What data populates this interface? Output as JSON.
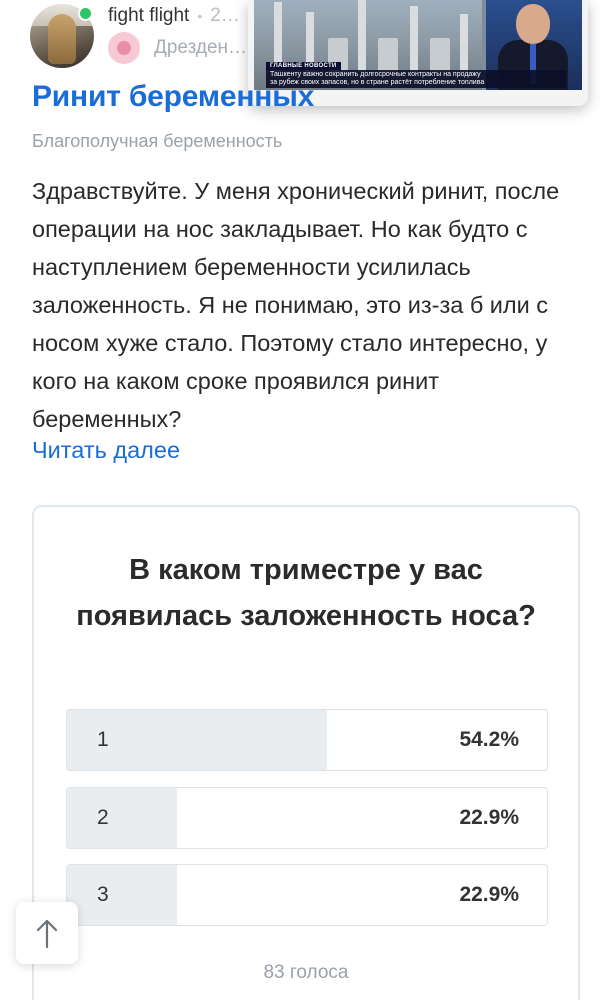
{
  "post": {
    "author": "fight flight",
    "date": "2…",
    "community": "Дрезден…",
    "title": "Ринит беременных",
    "tag": "Благополучная беременность",
    "body": "Здравствуйте. У меня хронический ринит, после операции на нос закладывает. Но как будто с наступлением беременности усилилась заложенность. Я не понимаю, это из-за б или с носом хуже стало. Поэтому стало интересно, у кого на каком сроке проявился ринит беременных?",
    "read_more": "Читать далее"
  },
  "pip_video": {
    "badge": "ГЛАВНЫЕ НОВОСТИ",
    "ticker_line1": "Ташкенту важно сохранить долгосрочные контракты на продажу",
    "ticker_line2": "за рубеж своих запасов, но в стране растёт потребление топлива"
  },
  "poll": {
    "question": "В каком триместре у вас появилась заложенность носа?",
    "options": [
      {
        "label": "1",
        "percent_text": "54.2%",
        "fraction": 0.542
      },
      {
        "label": "2",
        "percent_text": "22.9%",
        "fraction": 0.229
      },
      {
        "label": "3",
        "percent_text": "22.9%",
        "fraction": 0.229
      }
    ],
    "votes": "83 голоса"
  },
  "icons": {
    "scroll_top": "arrow-up-icon",
    "online": "online-status-icon"
  },
  "colors": {
    "accent": "#1a6cd6",
    "online": "#2fc46a",
    "bar_fill": "#e9edf0"
  }
}
